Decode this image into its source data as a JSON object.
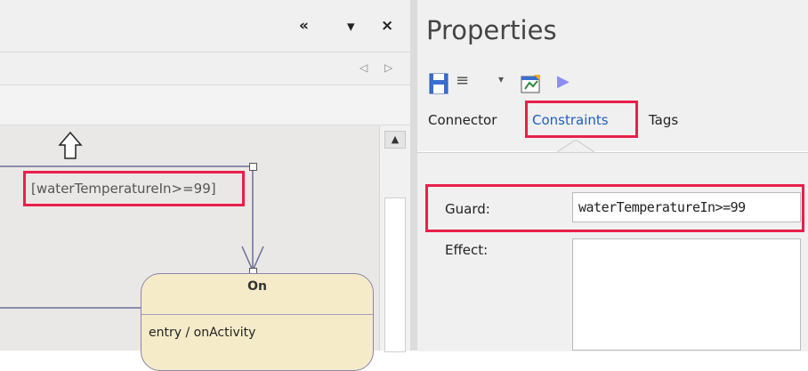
{
  "diagram": {
    "top_controls": {
      "collapse_icon": "«",
      "dropdown_icon": "▾",
      "close_icon": "×"
    },
    "tab_nav": {
      "prev": "◁",
      "next": "▷"
    },
    "guard_label": "[waterTemperatureIn>=99]",
    "state": {
      "name": "On",
      "entry": "entry / onActivity"
    },
    "scroll_up": "▲"
  },
  "properties": {
    "title": "Properties",
    "toolbar": {
      "save_icon": "save-icon",
      "menu_icon": "≡",
      "menu_dropdown": "▾",
      "run_icon": "▶"
    },
    "tabs": [
      {
        "label": "Connector"
      },
      {
        "label": "Constraints",
        "selected": true
      },
      {
        "label": "Tags"
      }
    ],
    "fields": {
      "guard": {
        "label": "Guard:",
        "value": "waterTemperatureIn>=99"
      },
      "effect": {
        "label": "Effect:",
        "value": ""
      }
    }
  },
  "colors": {
    "highlight": "#e8204a",
    "state_fill": "#f6ebc9",
    "accent_blue": "#3a6fd0"
  }
}
